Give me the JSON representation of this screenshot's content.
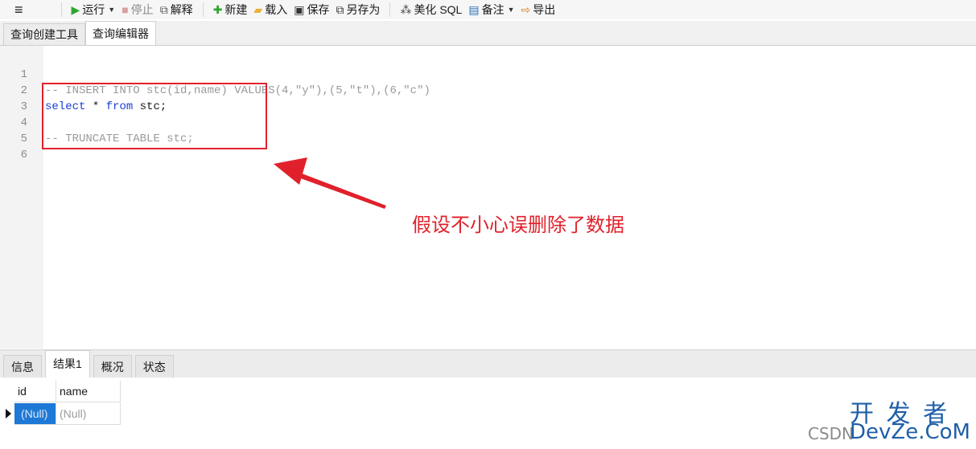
{
  "toolbar": {
    "menu_icon": "hamburger-icon",
    "run_label": "运行",
    "stop_label": "停止",
    "explain_label": "解释",
    "new_label": "新建",
    "load_label": "载入",
    "save_label": "保存",
    "save_as_label": "另存为",
    "beautify_label": "美化 SQL",
    "notes_label": "备注",
    "export_label": "导出"
  },
  "query_tabs": [
    "查询创建工具",
    "查询编辑器"
  ],
  "editor": {
    "lines": [
      {
        "num": "1",
        "text": "-- INSERT INTO stc(id,name) VALUES(4,\"y\"),(5,\"t\"),(6,\"c\")"
      },
      {
        "num": "2",
        "kw1": "select",
        "mid": " * ",
        "kw2": "from",
        "rest": " stc;"
      },
      {
        "num": "3",
        "text": ""
      },
      {
        "num": "4",
        "text": "-- TRUNCATE TABLE stc;"
      },
      {
        "num": "5",
        "text": ""
      },
      {
        "num": "6",
        "text": ""
      }
    ]
  },
  "annotation": {
    "note": "假设不小心误删除了数据",
    "color": "#e0212b"
  },
  "result_tabs": [
    "信息",
    "结果1",
    "概况",
    "状态"
  ],
  "result_grid": {
    "columns": [
      "id",
      "name"
    ],
    "rows": [
      [
        "(Null)",
        "(Null)"
      ]
    ]
  },
  "watermark": {
    "big": "开 发 者",
    "small_prefix": "CSDN",
    "domain": "DevZe.CoM"
  }
}
